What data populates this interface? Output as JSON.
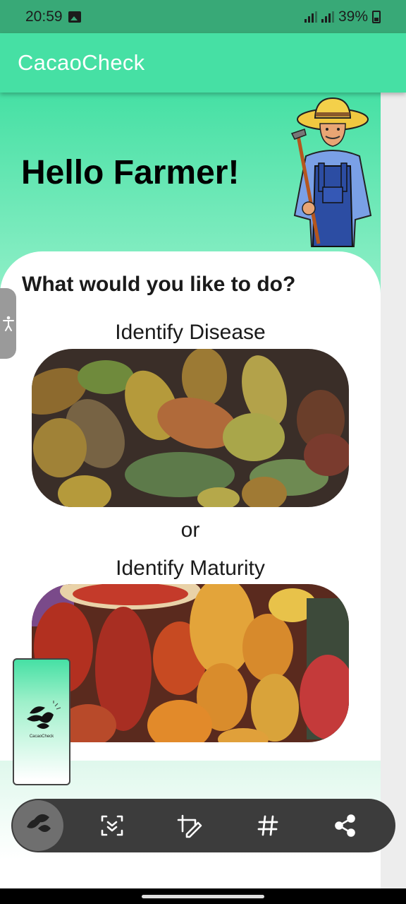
{
  "status_bar": {
    "time": "20:59",
    "battery": "39%",
    "icons": [
      "gallery-icon",
      "signal-icon",
      "signal-icon",
      "battery-icon"
    ]
  },
  "app_bar": {
    "title": "CacaoCheck"
  },
  "main": {
    "greeting": "Hello Farmer!",
    "question": "What would you like to do?",
    "option_disease": "Identify Disease",
    "separator": "or",
    "option_maturity": "Identify Maturity"
  },
  "thumbnail": {
    "logo_text": "CacaoCheck"
  },
  "toolbar": {
    "icons": [
      "app-thumbnail",
      "scroll-capture-icon",
      "edit-icon",
      "hashtag-icon",
      "share-icon"
    ]
  },
  "colors": {
    "primary": "#46e0a4",
    "status_bar": "#38a977",
    "toolbar": "#3c3c3c"
  }
}
